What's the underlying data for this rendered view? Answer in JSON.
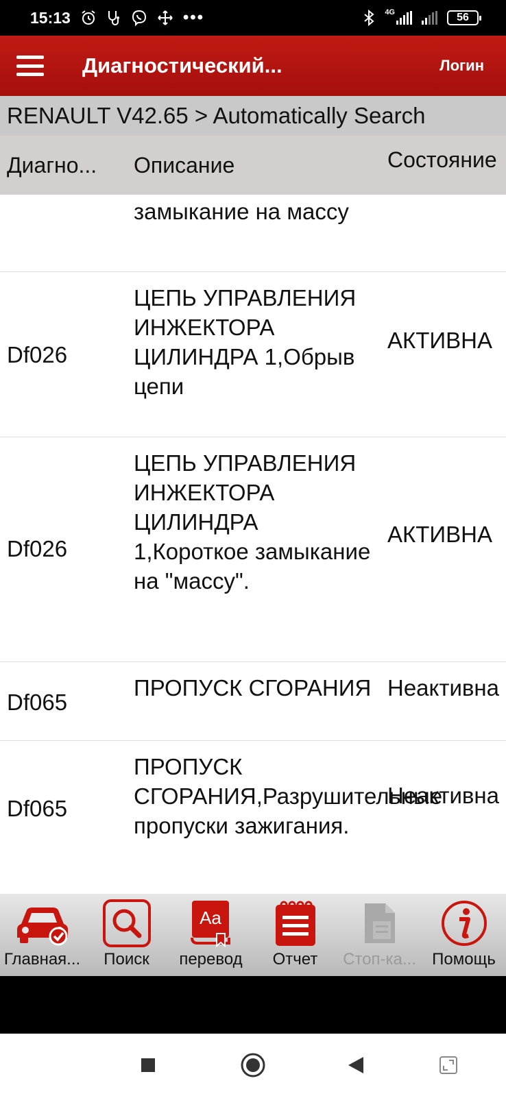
{
  "status": {
    "time": "15:13",
    "battery": "56",
    "network": "4G"
  },
  "appbar": {
    "title": "Диагностический...",
    "login": "Логин"
  },
  "breadcrumb": "RENAULT V42.65 > Automatically Search",
  "table": {
    "headers": [
      "Диагно...",
      "Описание",
      "Состояние"
    ],
    "partial_row": {
      "desc": "или короткое замыкание на массу"
    },
    "rows": [
      {
        "code": "Df026",
        "desc": "ЦЕПЬ УПРАВЛЕНИЯ ИНЖЕКТОРА ЦИЛИНДРА 1,Обрыв цепи",
        "state": "АКТИВНА"
      },
      {
        "code": "Df026",
        "desc": "ЦЕПЬ УПРАВЛЕНИЯ ИНЖЕКТОРА ЦИЛИНДРА 1,Короткое замыкание на \"массу\".",
        "state": "АКТИВНА"
      },
      {
        "code": "Df065",
        "desc": "ПРОПУСК СГОРАНИЯ",
        "state": "Неактивна"
      },
      {
        "code": "Df065",
        "desc": "ПРОПУСК СГОРАНИЯ,Разрушительные пропуски зажигания.",
        "state": "Неактивна"
      }
    ]
  },
  "toolbar": [
    {
      "label": "Главная...",
      "icon": "car-check-icon"
    },
    {
      "label": "Поиск",
      "icon": "search-icon"
    },
    {
      "label": "перевод",
      "icon": "translate-book-icon"
    },
    {
      "label": "Отчет",
      "icon": "report-notepad-icon"
    },
    {
      "label": "Стоп-ка...",
      "icon": "freeze-frame-document-icon",
      "disabled": true
    },
    {
      "label": "Помощь",
      "icon": "info-help-icon"
    }
  ],
  "colors": {
    "accent": "#b3140f",
    "header_bg": "#c9c9c9",
    "table_header_bg": "#d4cfcf"
  }
}
